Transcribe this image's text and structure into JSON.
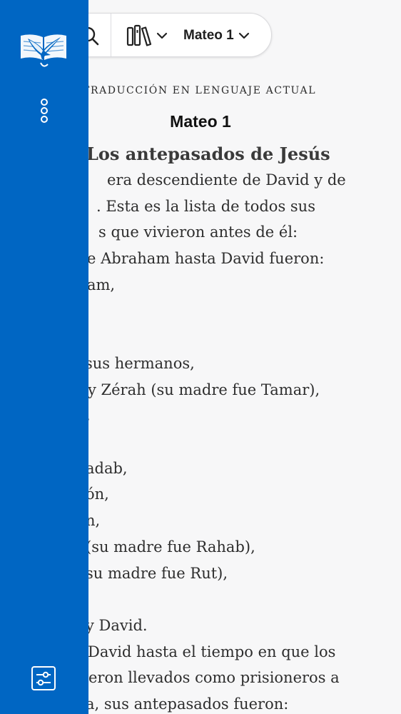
{
  "toolbar": {
    "chapter_label": "Mateo 1",
    "icons": [
      "search-icon",
      "library-icon",
      "chevron-down-icon"
    ]
  },
  "passage": {
    "version_name": "TRADUCCIÓN EN LENGUAJE ACTUAL",
    "chapter_title": "Mateo 1",
    "section_heading": "Los antepasados de Jesús",
    "lines": [
      "era descendiente de David y de",
      ". Esta es la lista de todos sus",
      "s que vivieron antes de él:",
      "e Abraham hasta David fueron:",
      "am,",
      "",
      "",
      "sus hermanos,",
      " y Zérah (su madre fue Tamar),",
      ",",
      "",
      "adab,",
      "ón,",
      "n,",
      "(su madre fue Rahab),",
      "su madre fue Rut),",
      "",
      "y David.",
      "David hasta el tiempo en que los",
      "eron llevados como prisioneros a",
      "a, sus antepasados fueron:"
    ]
  },
  "drawer": {
    "background_color": "#0066c3",
    "icons": [
      "bible-eagle-logo-icon",
      "more-options-icon",
      "settings-sliders-icon"
    ]
  }
}
